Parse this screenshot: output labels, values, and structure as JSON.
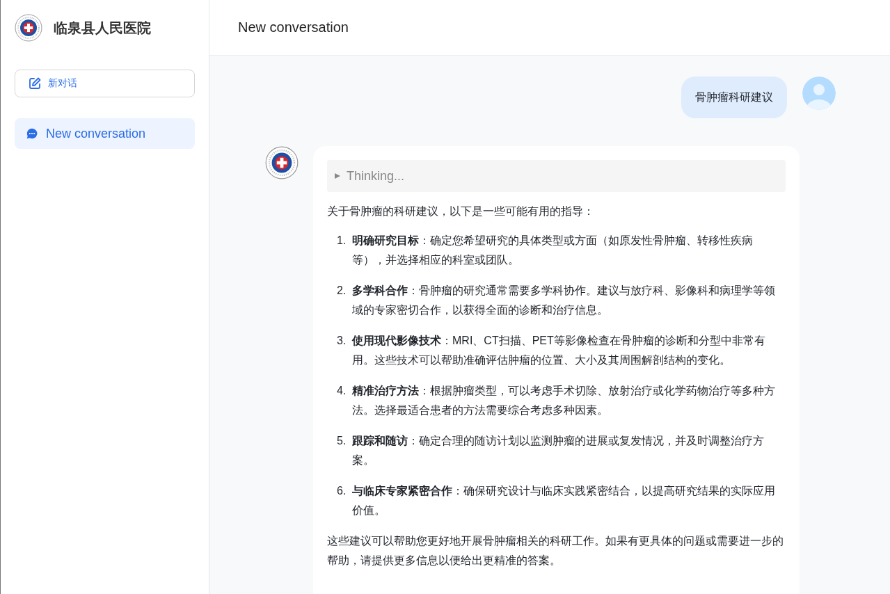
{
  "sidebar": {
    "hospital_name": "临泉县人民医院",
    "new_chat_button": "新对话",
    "conversations": [
      {
        "title": "New conversation",
        "selected": true
      }
    ]
  },
  "header": {
    "title": "New conversation"
  },
  "messages": [
    {
      "kind": "user",
      "text": "骨肿瘤科研建议"
    },
    {
      "kind": "assistant",
      "thinking": "Thinking...",
      "intro": "关于骨肿瘤的科研建议，以下是一些可能有用的指导：",
      "items": [
        {
          "number": "1.",
          "text": "**明确研究目标**：确定您希望研究的具体类型或方面（如原发性骨肿瘤、转移性疾病等），并选择相应的科室或团队。"
        },
        {
          "number": "2.",
          "text": "**多学科合作**：骨肿瘤的研究通常需要多学科协作。建议与放疗科、影像科和病理学等领域的专家密切合作，以获得全面的诊断和治疗信息。"
        },
        {
          "number": "3.",
          "text": "**使用现代影像技术**：MRI、CT扫描、PET等影像检查在骨肿瘤的诊断和分型中非常有用。这些技术可以帮助准确评估肿瘤的位置、大小及其周围解剖结构的变化。"
        },
        {
          "number": "4.",
          "text": "**精准治疗方法**：根据肿瘤类型，可以考虑手术切除、放射治疗或化学药物治疗等多种方法。选择最适合患者的方法需要综合考虑多种因素。"
        },
        {
          "number": "5.",
          "text": "**跟踪和随访**：确定合理的随访计划以监测肿瘤的进展或复发情况，并及时调整治疗方案。"
        },
        {
          "number": "6.",
          "text": "**与临床专家紧密合作**：确保研究设计与临床实践紧密结合，以提高研究结果的实际应用价值。"
        }
      ],
      "outro": "这些建议可以帮助您更好地开展骨肿瘤相关的科研工作。如果有更具体的问题或需要进一步的帮助，请提供更多信息以便给出更精准的答案。"
    }
  ]
}
